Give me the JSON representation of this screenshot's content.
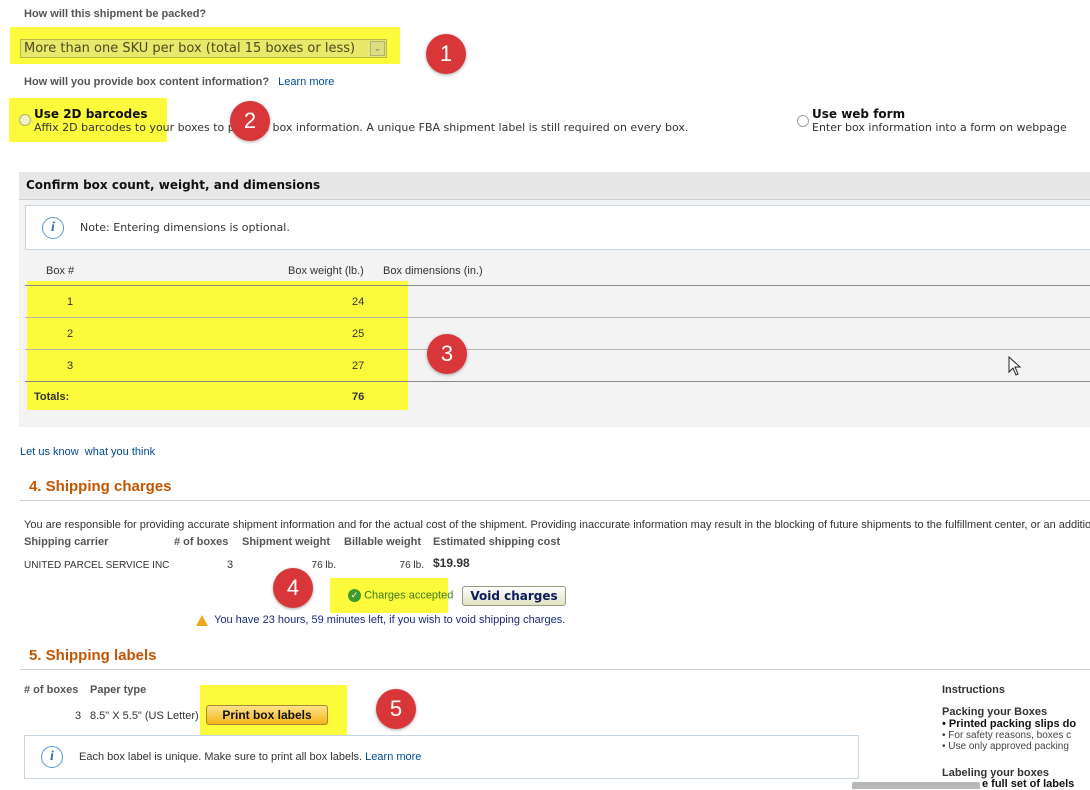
{
  "packing": {
    "question": "How will this shipment be packed?",
    "selected": "More than one SKU per box (total 15 boxes or less)"
  },
  "box_content": {
    "question": "How will you provide box content information?",
    "learn_more": "Learn more",
    "option_barcodes": {
      "title": "Use 2D barcodes",
      "desc": "Affix 2D barcodes to your boxes to provide box information. A unique FBA shipment label is still required on every box."
    },
    "option_webform": {
      "title": "Use web form",
      "desc": "Enter box information into a form on webpage"
    }
  },
  "confirm": {
    "title": "Confirm box count, weight, and dimensions",
    "note": "Note: Entering dimensions is optional.",
    "headers": {
      "box": "Box #",
      "weight": "Box weight (lb.)",
      "dims": "Box dimensions (in.)"
    },
    "rows": [
      {
        "box": "1",
        "weight": "24"
      },
      {
        "box": "2",
        "weight": "25"
      },
      {
        "box": "3",
        "weight": "27"
      }
    ],
    "totals_label": "Totals:",
    "totals_weight": "76"
  },
  "feedback": {
    "prefix": "Let us know",
    "link": "what you think"
  },
  "shipping_charges": {
    "title": "4. Shipping charges",
    "disclaimer": "You are responsible for providing accurate shipment information and for the actual cost of the shipment. Providing inaccurate information may result in the blocking of future shipments to the fulfillment center, or an additional",
    "headers": {
      "carrier": "Shipping carrier",
      "boxes": "# of boxes",
      "ship_weight": "Shipment weight",
      "bill_weight": "Billable weight",
      "cost": "Estimated shipping cost"
    },
    "row": {
      "carrier": "UNITED PARCEL SERVICE INC",
      "boxes": "3",
      "ship_weight": "76 lb.",
      "bill_weight": "76 lb.",
      "cost": "$19.98"
    },
    "accepted": "Charges accepted",
    "void_button": "Void charges",
    "warning": "You have 23 hours, 59 minutes left, if you wish to void shipping charges."
  },
  "shipping_labels": {
    "title": "5. Shipping labels",
    "headers": {
      "boxes": "# of boxes",
      "paper": "Paper type"
    },
    "row": {
      "boxes": "3",
      "paper": "8.5\" X 5.5\" (US Letter)"
    },
    "print_button": "Print box labels",
    "note": "Each box label is unique. Make sure to print all box labels.",
    "note_link": "Learn more"
  },
  "instructions": {
    "title": "Instructions",
    "packing_title": "Packing your Boxes",
    "packing_items": [
      "Printed packing slips do",
      "For safety reasons, boxes c",
      "Use only approved packing"
    ],
    "labeling_title": "Labeling your boxes",
    "labeling_item": "e full set of labels"
  },
  "annotations": [
    "1",
    "2",
    "3",
    "4",
    "5"
  ],
  "colors": {
    "highlight": "#fbfb3c",
    "badge": "#d9363a",
    "section_title": "#c45500",
    "link": "#004b91"
  }
}
